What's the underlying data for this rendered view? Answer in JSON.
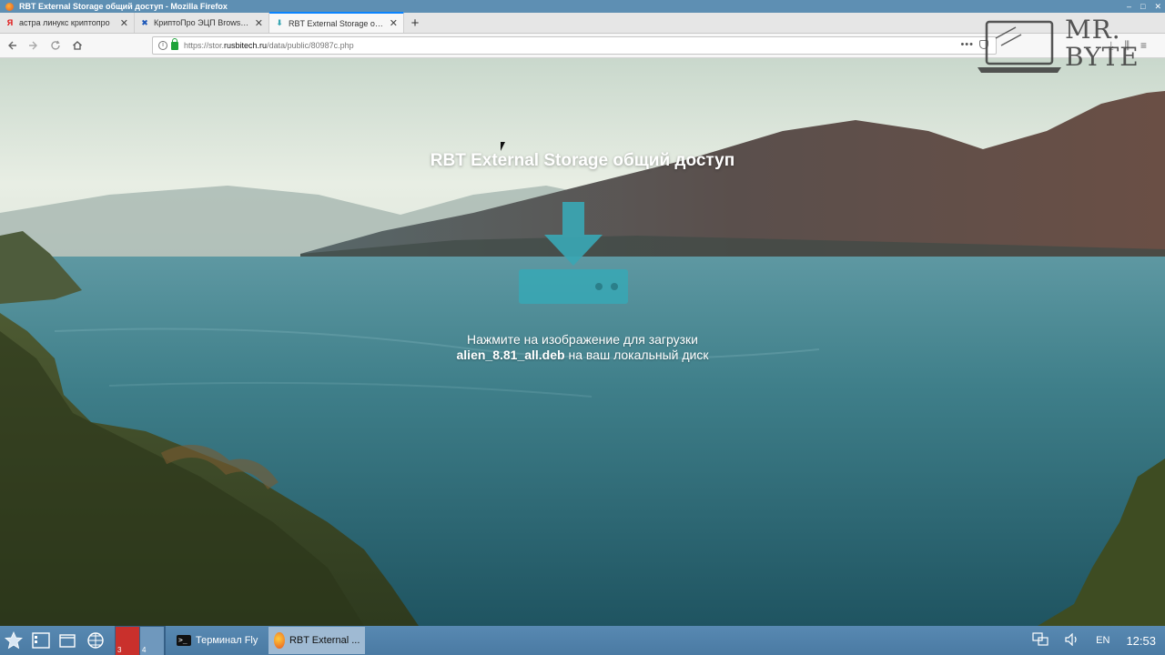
{
  "window": {
    "title": "RBT External Storage общий доступ - Mozilla Firefox",
    "controls": [
      "–",
      "□",
      "✕"
    ]
  },
  "tabs": [
    {
      "label": "астра линукс криптопро",
      "icon": "yandex-icon",
      "active": false
    },
    {
      "label": "КриптоПро ЭЦП Browser plug-in",
      "icon": "cryptopro-icon",
      "active": false
    },
    {
      "label": "RBT External Storage общий доступ",
      "icon": "download-icon",
      "active": true
    }
  ],
  "newtab_label": "+",
  "urlbar": {
    "url_prefix": "https://stor.",
    "url_domain": "rusbitech.ru",
    "url_path": "/data/public/80987c.php",
    "dots": "•••"
  },
  "page": {
    "title": "RBT External Storage общий доступ",
    "desc_before": "Нажмите на изображение для загрузки ",
    "filename": "alien_8.81_all.deb",
    "desc_after": " на ваш локальный диск"
  },
  "watermark": {
    "line1": "MR.",
    "line2": "BYTE"
  },
  "taskbar": {
    "pager": [
      "3",
      "4"
    ],
    "tasks": [
      {
        "label": "Терминал Fly",
        "icon": "terminal-icon",
        "active": false
      },
      {
        "label": "RBT External ...",
        "icon": "firefox-icon",
        "active": true
      }
    ],
    "lang": "EN",
    "clock": "12:53"
  },
  "colors": {
    "accent": "#0a84ff",
    "taskbar": "#4f7fa8",
    "download_icon": "#3aa6b3"
  }
}
